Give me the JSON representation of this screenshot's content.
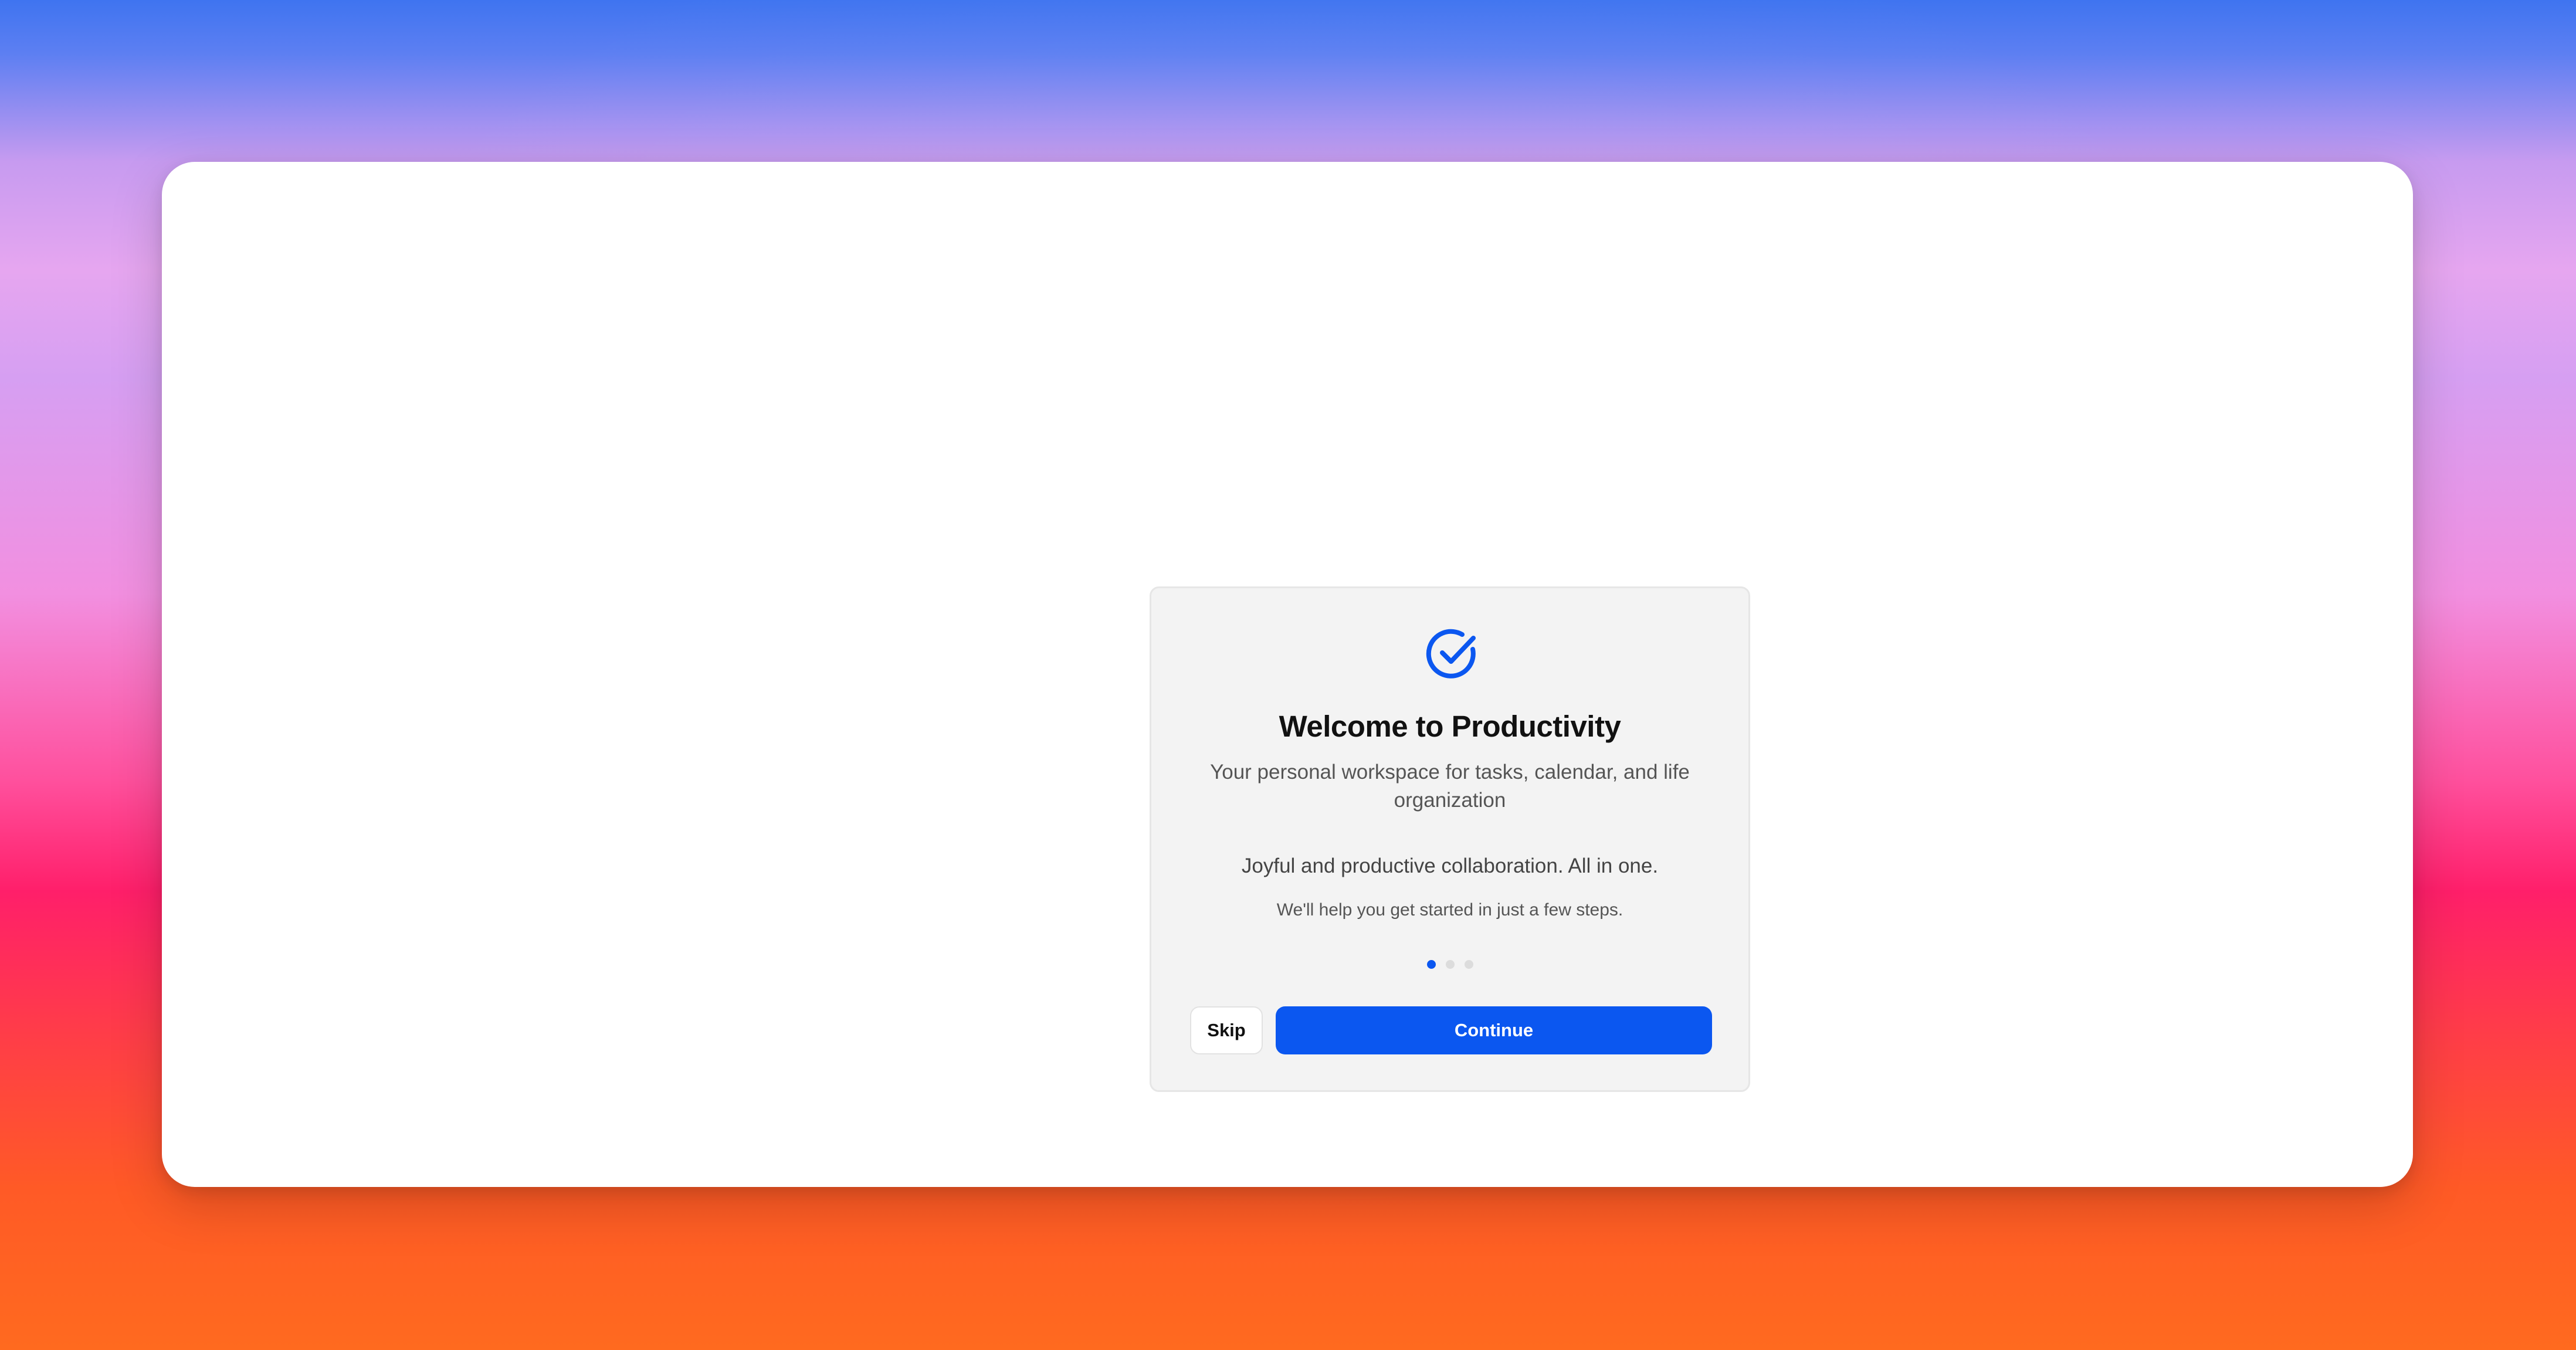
{
  "colors": {
    "accent": "#0b57f0",
    "dialog_bg": "#f3f3f3",
    "window_bg": "#ffffff"
  },
  "onboarding": {
    "icon": "check-circle-icon",
    "title": "Welcome to Productivity",
    "subtitle": "Your personal workspace for tasks, calendar, and life organization",
    "tagline": "Joyful and productive collaboration. All in one.",
    "helper": "We'll help you get started in just a few steps.",
    "pager": {
      "total_steps": 3,
      "current_step": 1
    },
    "skip_label": "Skip",
    "continue_label": "Continue"
  }
}
